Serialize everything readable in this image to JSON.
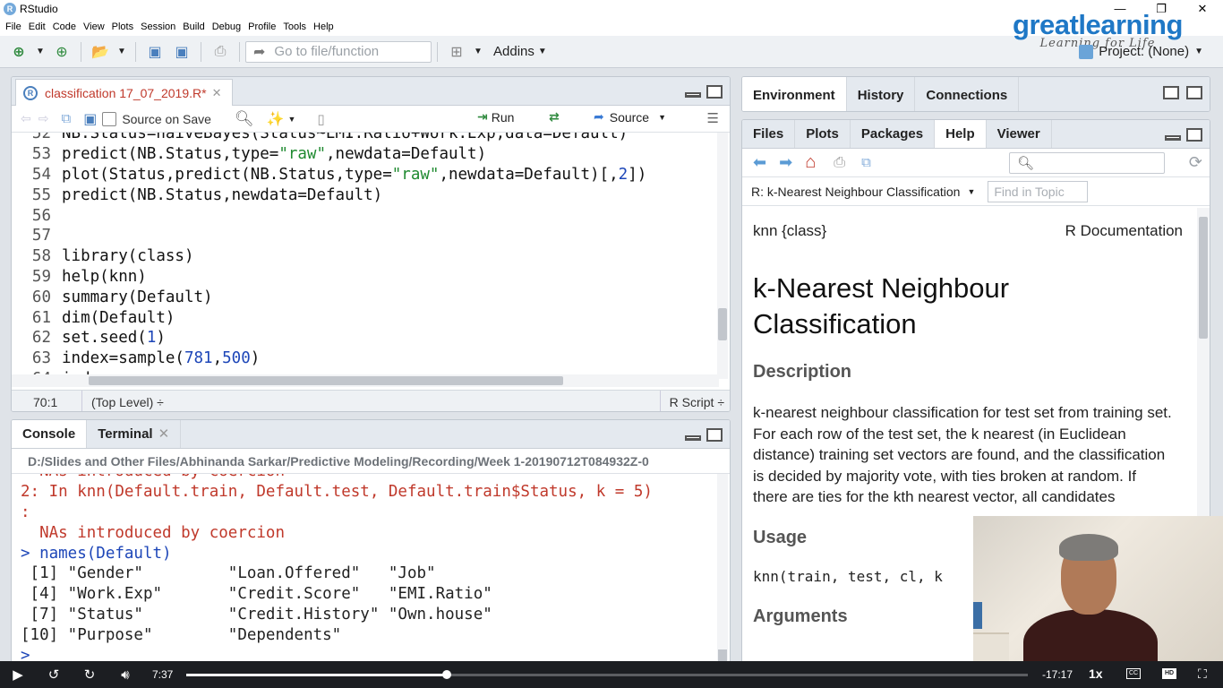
{
  "window": {
    "title": "RStudio",
    "app_icon": "R"
  },
  "menu": [
    "File",
    "Edit",
    "Code",
    "View",
    "Plots",
    "Session",
    "Build",
    "Debug",
    "Profile",
    "Tools",
    "Help"
  ],
  "toolbar": {
    "goto_placeholder": "Go to file/function",
    "addins_label": "Addins"
  },
  "logo": {
    "brand": "greatlearning",
    "tagline": "Learning for Life"
  },
  "project": {
    "label": "Project: (None)"
  },
  "source": {
    "tab_label": "classification 17_07_2019.R*",
    "source_on_save": "Source on Save",
    "run_label": "Run",
    "source_label": "Source",
    "lines": [
      {
        "n": "52",
        "code": "NB.Status=naiveBayes(Status~EMI.Ratio+Work.Exp,data=Default)"
      },
      {
        "n": "53",
        "code": "predict(NB.Status,type=\"raw\",newdata=Default)"
      },
      {
        "n": "54",
        "code": "plot(Status,predict(NB.Status,type=\"raw\",newdata=Default)[,2])"
      },
      {
        "n": "55",
        "code": "predict(NB.Status,newdata=Default)"
      },
      {
        "n": "56",
        "code": ""
      },
      {
        "n": "57",
        "code": ""
      },
      {
        "n": "58",
        "code": "library(class)"
      },
      {
        "n": "59",
        "code": "help(knn)"
      },
      {
        "n": "60",
        "code": "summary(Default)"
      },
      {
        "n": "61",
        "code": "dim(Default)"
      },
      {
        "n": "62",
        "code": "set.seed(1)"
      },
      {
        "n": "63",
        "code": "index=sample(781,500)"
      },
      {
        "n": "64",
        "code": "ind..."
      }
    ],
    "status_position": "70:1",
    "status_level": "(Top Level) ÷",
    "status_type": "R Script ÷"
  },
  "console": {
    "tabs": [
      "Console",
      "Terminal"
    ],
    "path": "D:/Slides and Other Files/Abhinanda Sarkar/Predictive Modeling/Recording/Week 1-20190712T084932Z-0",
    "lines": [
      {
        "cls": "red",
        "text": "  NAs introduced by coercion"
      },
      {
        "cls": "red",
        "text": "2: In knn(Default.train, Default.test, Default.train$Status, k = 5)"
      },
      {
        "cls": "red",
        "text": ":"
      },
      {
        "cls": "red",
        "text": "  NAs introduced by coercion"
      },
      {
        "cls": "prompt",
        "text": "> names(Default)"
      },
      {
        "cls": "",
        "text": " [1] \"Gender\"         \"Loan.Offered\"   \"Job\""
      },
      {
        "cls": "",
        "text": " [4] \"Work.Exp\"       \"Credit.Score\"   \"EMI.Ratio\""
      },
      {
        "cls": "",
        "text": " [7] \"Status\"         \"Credit.History\" \"Own.house\""
      },
      {
        "cls": "",
        "text": "[10] \"Purpose\"        \"Dependents\""
      },
      {
        "cls": "prompt",
        "text": "> "
      }
    ]
  },
  "env_tabs": [
    "Environment",
    "History",
    "Connections"
  ],
  "help": {
    "tabs": [
      "Files",
      "Plots",
      "Packages",
      "Help",
      "Viewer"
    ],
    "topic": "R: k-Nearest Neighbour Classification",
    "find_placeholder": "Find in Topic",
    "doc_left": "knn {class}",
    "doc_right": "R Documentation",
    "title": "k-Nearest Neighbour Classification",
    "description_heading": "Description",
    "description": "k-nearest neighbour classification for test set from training set. For each row of the test set, the k nearest (in Euclidean distance) training set vectors are found, and the classification is decided by majority vote, with ties broken at random. If there are ties for the kth nearest vector, all candidates",
    "usage_heading": "Usage",
    "usage": "knn(train, test, cl, k",
    "arguments_heading": "Arguments"
  },
  "video": {
    "elapsed": "7:37",
    "remaining": "-17:17",
    "speed": "1x",
    "progress": 0.31
  }
}
